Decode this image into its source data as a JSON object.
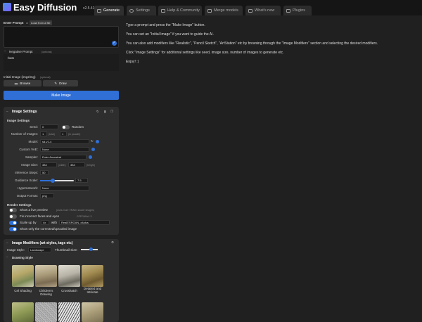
{
  "header": {
    "title": "Easy Diffusion",
    "version": "v2.5.41 (beta)",
    "tabs": [
      {
        "label": "Generate"
      },
      {
        "label": "Settings"
      },
      {
        "label": "Help & Community"
      },
      {
        "label": "Merge models"
      },
      {
        "label": "What's new"
      },
      {
        "label": "Plugins"
      }
    ]
  },
  "prompt": {
    "label": "Enter Prompt",
    "or": "or",
    "load_file": "Load from a file",
    "negative_label": "Negative Prompt",
    "negative_optional": "(optional)",
    "negative_value": "-bats",
    "init_image_label": "Initial Image (img2img)",
    "init_image_optional": "(optional)",
    "browse": "Browse",
    "draw": "Draw",
    "make_image": "Make Image"
  },
  "image_settings": {
    "title": "Image Settings",
    "section": "Image Settings",
    "seed_label": "Seed:",
    "seed_value": "0",
    "random_label": "Random",
    "num_images_label": "Number of Images:",
    "num_images_value": "1",
    "total_label": "(total)",
    "parallel_value": "1",
    "parallel_label": "(in parallel)",
    "model_label": "Model:",
    "model_value": "sd-v1-4",
    "vae_label": "Custom VAE:",
    "vae_value": "None",
    "sampler_label": "Sampler:",
    "sampler_value": "Euler Ancestral",
    "size_label": "Image Size:",
    "width_value": "384",
    "width_unit": "(width)",
    "height_value": "384",
    "height_unit": "(height)",
    "steps_label": "Inference Steps:",
    "steps_value": "50",
    "guidance_label": "Guidance Scale:",
    "guidance_value": "7.5",
    "guidance_fraction": 0.37,
    "hypernet_label": "Hypernetwork:",
    "hypernet_value": "None",
    "format_label": "Output Format:",
    "format_value": "png",
    "render_title": "Render Settings",
    "preview_label": "Show a live preview",
    "preview_hint": "(uses more VRAM, slower images)",
    "faces_label": "Fix incorrect faces and eyes",
    "faces_model": "GFPGANv1.3",
    "scale_label": "Scale up by",
    "scale_value": "4x",
    "scale_with": "with",
    "scale_model": "RealESRGAN_x4plus",
    "corrected_label": "Show only the corrected/upscaled image"
  },
  "modifiers": {
    "title": "Image Modifiers (art styles, tags etc)",
    "style_label": "Image Style:",
    "style_value": "Landscape",
    "thumb_size_label": "Thumbnail Size:",
    "thumb_fraction": 0.6,
    "category": "Drawing Style",
    "items": [
      {
        "label": "Cel Shading"
      },
      {
        "label": "Children's Drawing"
      },
      {
        "label": "Crosshatch"
      },
      {
        "label": "Detailed and Intricate"
      }
    ]
  },
  "info": {
    "line1": "Type a prompt and press the \"Make Image\" button.",
    "line2": "You can set an \"Initial Image\" if you want to guide the AI.",
    "line3": "You can also add modifiers like \"Realistic\", \"Pencil Sketch\", \"ArtStation\" etc by browsing through the \"Image Modifiers\" section and selecting the desired modifiers.",
    "line4": "Click \"Image Settings\" for additional settings like seed, image size, number of images to generate etc.",
    "line5": "Enjoy! :)"
  },
  "colors": {
    "accent": "#2f6fd6",
    "background": "#202020",
    "panel": "#2e2e2e",
    "header": "#151515"
  }
}
